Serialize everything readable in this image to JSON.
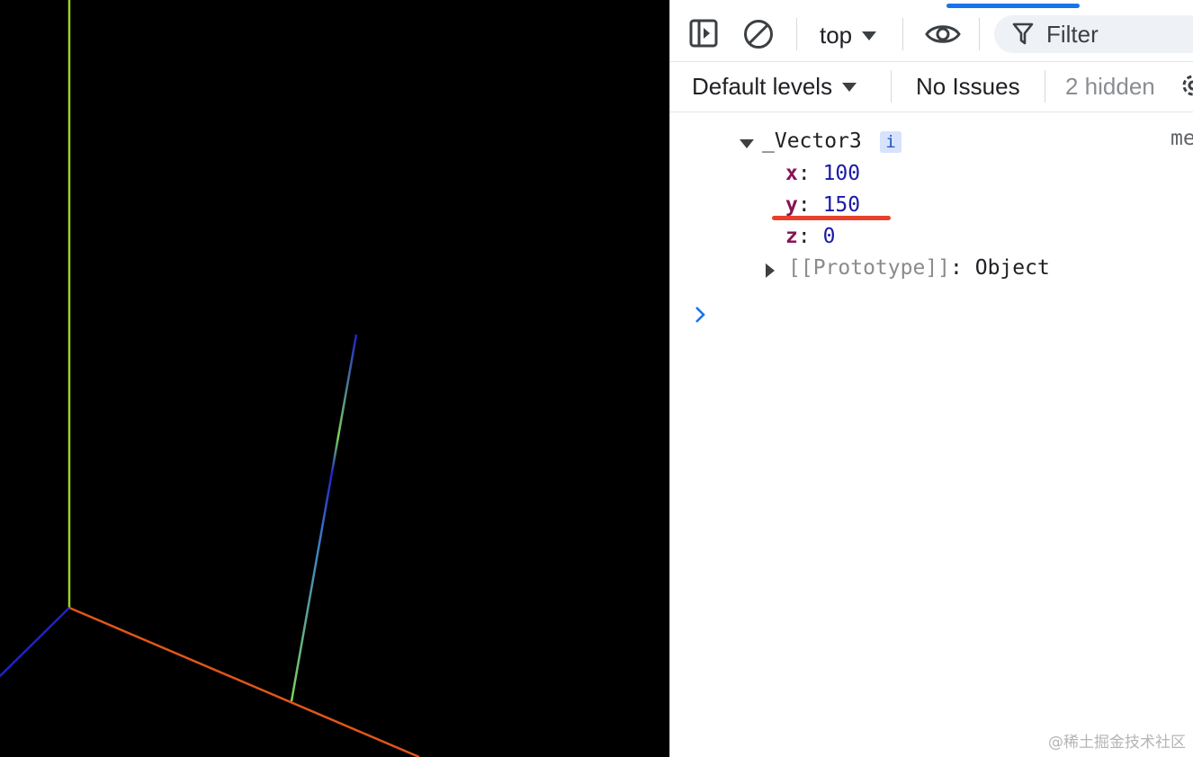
{
  "viewport": {
    "background": "#000000",
    "axis_colors": {
      "x": "#e0561a",
      "y": "#9ccf28",
      "z": "#1d24c8"
    },
    "gradient_line_colors": [
      "#1d24c8",
      "#7dd25a"
    ]
  },
  "devtools": {
    "toolbar": {
      "sidebar_icon": "sidebar-toggle-icon",
      "clear_icon": "clear-console-icon",
      "context_label": "top",
      "eye_icon": "eye-icon",
      "filter_icon": "filter-icon",
      "filter_placeholder": "Filter"
    },
    "subtoolbar": {
      "levels_label": "Default levels",
      "issues_label": "No Issues",
      "hidden_label": "2 hidden",
      "settings_icon": "gear-icon"
    },
    "console": {
      "object_name": "_Vector3",
      "info_badge": "i",
      "source_link": "me",
      "properties": [
        {
          "key": "x",
          "value": "100"
        },
        {
          "key": "y",
          "value": "150"
        },
        {
          "key": "z",
          "value": "0"
        }
      ],
      "prototype_label": "[[Prototype]]",
      "prototype_value": "Object",
      "prompt_symbol": "›"
    },
    "annotation_color": "#e8402a",
    "accent_color": "#1a73e8"
  },
  "watermark": "@稀土掘金技术社区"
}
